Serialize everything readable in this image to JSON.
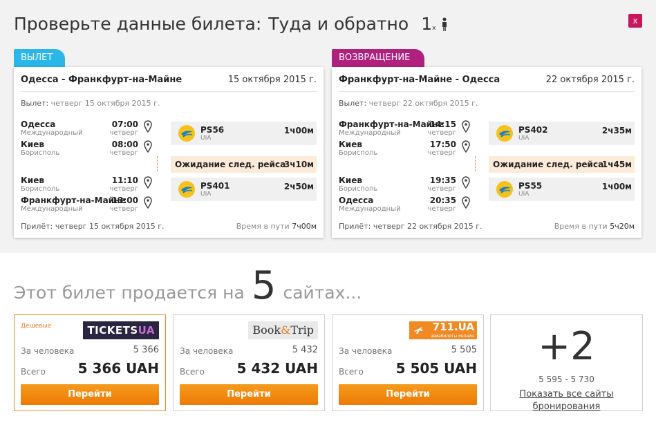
{
  "header": {
    "title": "Проверьте данные билета:",
    "trip_type": "Туда и обратно",
    "passengers": "1",
    "passengers_x": "x",
    "close_label": "x"
  },
  "outbound": {
    "tab_label": "ВЫЛЕТ",
    "route": "Одесса - Франкфурт-на-Майне",
    "date": "15 октября 2015 г.",
    "departure_label": "Вылет:",
    "departure_value": "четверг 15 октября 2015 г.",
    "stops": [
      {
        "city": "Одесса",
        "airport": "Международный",
        "time": "07:00",
        "day": "четверг"
      },
      {
        "city": "Киев",
        "airport": "Борисполь",
        "time": "08:00",
        "day": "четверг"
      },
      {
        "city": "Киев",
        "airport": "Борисполь",
        "time": "11:10",
        "day": "четверг"
      },
      {
        "city": "Франкфурт-на-Майне",
        "airport": "Международный",
        "time": "13:00",
        "day": "четверг"
      }
    ],
    "flights": [
      {
        "number": "PS56",
        "airline": "UIA",
        "duration": "1ч00м"
      },
      {
        "number": "PS401",
        "airline": "UIA",
        "duration": "2ч50м"
      }
    ],
    "wait": {
      "label": "Ожидание след. рейса",
      "duration": "3ч10м"
    },
    "arrival_label": "Прилёт:",
    "arrival_value": "четверг 15 октября 2015 г.",
    "travel_label": "Время в пути",
    "travel_value": "7ч00м"
  },
  "return": {
    "tab_label": "ВОЗВРАЩЕНИЕ",
    "route": "Франкфурт-на-Майне - Одесса",
    "date": "22 октября 2015 г.",
    "departure_label": "Вылет:",
    "departure_value": "четверг 22 октября 2015 г.",
    "stops": [
      {
        "city": "Франкфурт-на-Майне",
        "airport": "Международный",
        "time": "14:15",
        "day": "четверг"
      },
      {
        "city": "Киев",
        "airport": "Борисполь",
        "time": "17:50",
        "day": "четверг"
      },
      {
        "city": "Киев",
        "airport": "Борисполь",
        "time": "19:35",
        "day": "четверг"
      },
      {
        "city": "Одесса",
        "airport": "Международный",
        "time": "20:35",
        "day": "четверг"
      }
    ],
    "flights": [
      {
        "number": "PS402",
        "airline": "UIA",
        "duration": "2ч35м"
      },
      {
        "number": "PS55",
        "airline": "UIA",
        "duration": "1ч00м"
      }
    ],
    "wait": {
      "label": "Ожидание след. рейса",
      "duration": "1ч45м"
    },
    "arrival_label": "Прилёт:",
    "arrival_value": "четверг 22 октября 2015 г.",
    "travel_label": "Время в пути",
    "travel_value": "5ч20м"
  },
  "sellers": {
    "heading_pre": "Этот билет продается на",
    "count": "5",
    "heading_post": "сайтах...",
    "offers": [
      {
        "tag": "Дешевые",
        "brand_main": "TICKETS",
        "brand_accent": "UA",
        "per_label": "За человека",
        "per_value": "5 366",
        "total_label": "Всего",
        "total_value": "5 366 UAH",
        "button": "Перейти"
      },
      {
        "tag": "",
        "brand_main": "Book",
        "brand_amp": "&",
        "brand_tail": "Trip",
        "per_label": "За человека",
        "per_value": "5 432",
        "total_label": "Всего",
        "total_value": "5 432 UAH",
        "button": "Перейти"
      },
      {
        "tag": "",
        "brand_main": "711.UA",
        "brand_sub": "авиабилеты онлайн",
        "per_label": "За человека",
        "per_value": "5 505",
        "total_label": "Всего",
        "total_value": "5 505 UAH",
        "button": "Перейти"
      }
    ],
    "more": {
      "plus": "+2",
      "range": "5 595 - 5 730",
      "link": "Показать все сайты бронирования"
    }
  },
  "colors": {
    "outbound_tab": "#29b6e8",
    "return_tab": "#b0207f",
    "close_button": "#c8175a",
    "go_button": "#ee7a06",
    "wait_bg": "#fcebd8"
  },
  "icons": [
    "person-icon",
    "close-icon",
    "location-pin-icon",
    "uia-airline-logo",
    "plane-icon"
  ]
}
